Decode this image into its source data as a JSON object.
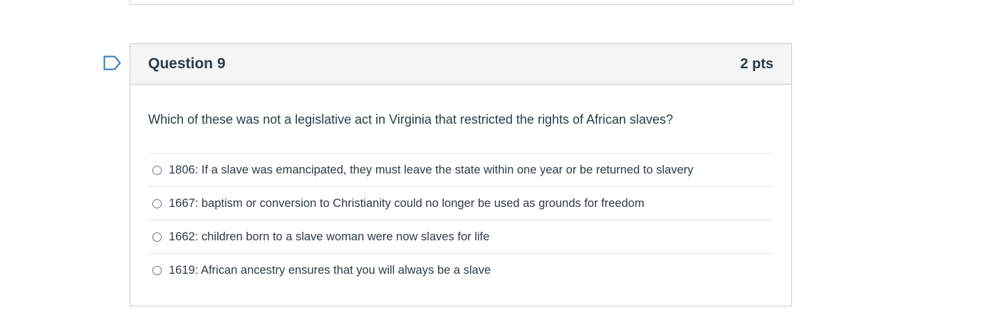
{
  "question": {
    "title": "Question 9",
    "points": "2 pts",
    "text": "Which of these was not a legislative act in Virginia that restricted the rights of African slaves?",
    "answers": [
      {
        "label": "1806: If a slave was emancipated, they must leave the state within one year or be returned to slavery",
        "selected": false
      },
      {
        "label": "1667: baptism or conversion to Christianity could no longer be used as grounds for freedom",
        "selected": false
      },
      {
        "label": "1662: children born to a slave woman were now slaves for life",
        "selected": false
      },
      {
        "label": "1619: African ancestry ensures that you will always be a slave",
        "selected": false
      }
    ]
  },
  "icons": {
    "flag": "bookmark-flag-icon"
  },
  "colors": {
    "text": "#2d3b45",
    "header_bg": "#f5f5f5",
    "border": "#c7cdd1",
    "flag_stroke": "#2b7abc"
  }
}
